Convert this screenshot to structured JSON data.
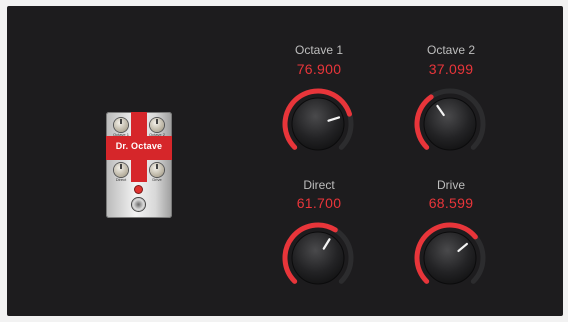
{
  "pedal": {
    "name": "Dr. Octave",
    "knob_labels": [
      "Octave 1",
      "Octave 2",
      "Direct",
      "Drive"
    ]
  },
  "controls": [
    {
      "label": "Octave 1",
      "value": "76.900",
      "level": 0.769
    },
    {
      "label": "Octave 2",
      "value": "37.099",
      "level": 0.371
    },
    {
      "label": "Direct",
      "value": "61.700",
      "level": 0.617
    },
    {
      "label": "Drive",
      "value": "68.599",
      "level": 0.686
    }
  ],
  "colors": {
    "background": "#1d1c1e",
    "accent": "#e8353a",
    "label": "#bdbdbd",
    "knob_track": "#2c2c2e"
  }
}
